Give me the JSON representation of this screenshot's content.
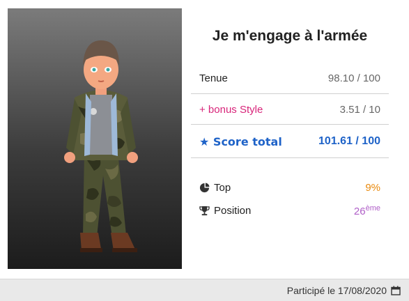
{
  "title": "Je m'engage à l'armée",
  "rows": [
    {
      "label": "Tenue",
      "value": "98.10 / 100"
    },
    {
      "label": "+ bonus Style",
      "value": "3.51 / 10"
    },
    {
      "label": "Score total",
      "value": "101.61 / 100"
    }
  ],
  "stats": {
    "top": {
      "label": "Top",
      "value": "9%"
    },
    "position": {
      "label": "Position",
      "value": "26",
      "suffix": "ème"
    }
  },
  "footer": {
    "text": "Participé le 17/08/2020"
  },
  "icons": {
    "score": "star-icon",
    "top": "pie-chart-icon",
    "position": "trophy-icon",
    "date": "calendar-icon"
  },
  "colors": {
    "bonus": "#d8257a",
    "score": "#1f63c8",
    "top": "#e98a0e",
    "position": "#b060c8"
  }
}
